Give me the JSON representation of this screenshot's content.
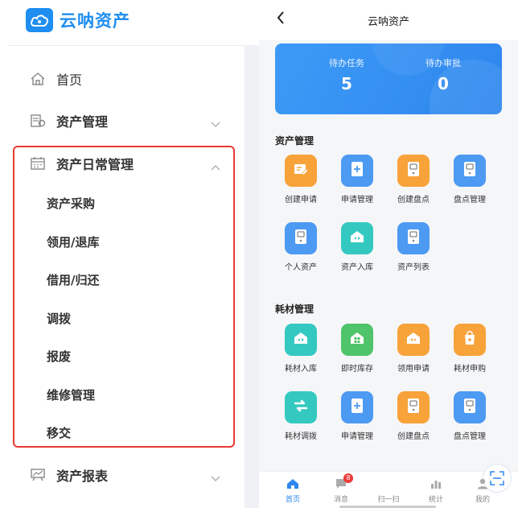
{
  "app": {
    "name": "云呐资产"
  },
  "colors": {
    "brand": "#1f8ef1",
    "highlight_border": "#ea3a35",
    "card": "#2e86ee",
    "orange": "#f8a23a",
    "blue": "#4d9af3",
    "teal": "#34c9c0",
    "green": "#4fc46a"
  },
  "sidebar": {
    "items": [
      {
        "label": "首页",
        "icon": "home-icon"
      },
      {
        "label": "资产管理",
        "icon": "asset-icon",
        "expandable": true,
        "expanded": false
      },
      {
        "label": "资产日常管理",
        "icon": "calendar-icon",
        "expandable": true,
        "expanded": true
      },
      {
        "label": "资产报表",
        "icon": "report-icon",
        "expandable": true,
        "expanded": false
      }
    ],
    "subitems": [
      {
        "label": "资产采购"
      },
      {
        "label": "领用/退库"
      },
      {
        "label": "借用/归还"
      },
      {
        "label": "调拨"
      },
      {
        "label": "报废"
      },
      {
        "label": "维修管理"
      },
      {
        "label": "移交"
      }
    ]
  },
  "mobile": {
    "title": "云呐资产",
    "stats": [
      {
        "label": "待办任务",
        "value": "5"
      },
      {
        "label": "待办审批",
        "value": "0"
      }
    ],
    "sections": [
      {
        "title": "资产管理",
        "items": [
          {
            "label": "创建申请",
            "color": "orange",
            "icon": "doc-edit-icon"
          },
          {
            "label": "申请管理",
            "color": "blue",
            "icon": "doc-plus-icon"
          },
          {
            "label": "创建盘点",
            "color": "orange",
            "icon": "inventory-icon"
          },
          {
            "label": "盘点管理",
            "color": "blue",
            "icon": "inventory-icon"
          },
          {
            "label": "个人资产",
            "color": "blue",
            "icon": "inventory-icon"
          },
          {
            "label": "资产入库",
            "color": "teal",
            "icon": "warehouse-in-icon"
          },
          {
            "label": "资产列表",
            "color": "blue",
            "icon": "inventory-icon"
          }
        ]
      },
      {
        "title": "耗材管理",
        "items": [
          {
            "label": "耗材入库",
            "color": "teal",
            "icon": "warehouse-in-icon"
          },
          {
            "label": "即时库存",
            "color": "green",
            "icon": "warehouse-grid-icon"
          },
          {
            "label": "领用申请",
            "color": "orange",
            "icon": "warehouse-out-icon"
          },
          {
            "label": "耗材申购",
            "color": "orange",
            "icon": "purchase-bag-icon"
          },
          {
            "label": "耗材调拨",
            "color": "teal",
            "icon": "transfer-icon"
          },
          {
            "label": "申请管理",
            "color": "blue",
            "icon": "doc-plus-icon"
          },
          {
            "label": "创建盘点",
            "color": "orange",
            "icon": "inventory-icon"
          },
          {
            "label": "盘点管理",
            "color": "blue",
            "icon": "inventory-icon"
          }
        ]
      }
    ],
    "tabs": [
      {
        "label": "首页",
        "icon": "home-icon",
        "active": true
      },
      {
        "label": "消息",
        "icon": "message-icon",
        "badge": "8"
      },
      {
        "label": "扫一扫",
        "icon": "scan-icon"
      },
      {
        "label": "统计",
        "icon": "chart-icon"
      },
      {
        "label": "我的",
        "icon": "user-icon"
      }
    ]
  }
}
